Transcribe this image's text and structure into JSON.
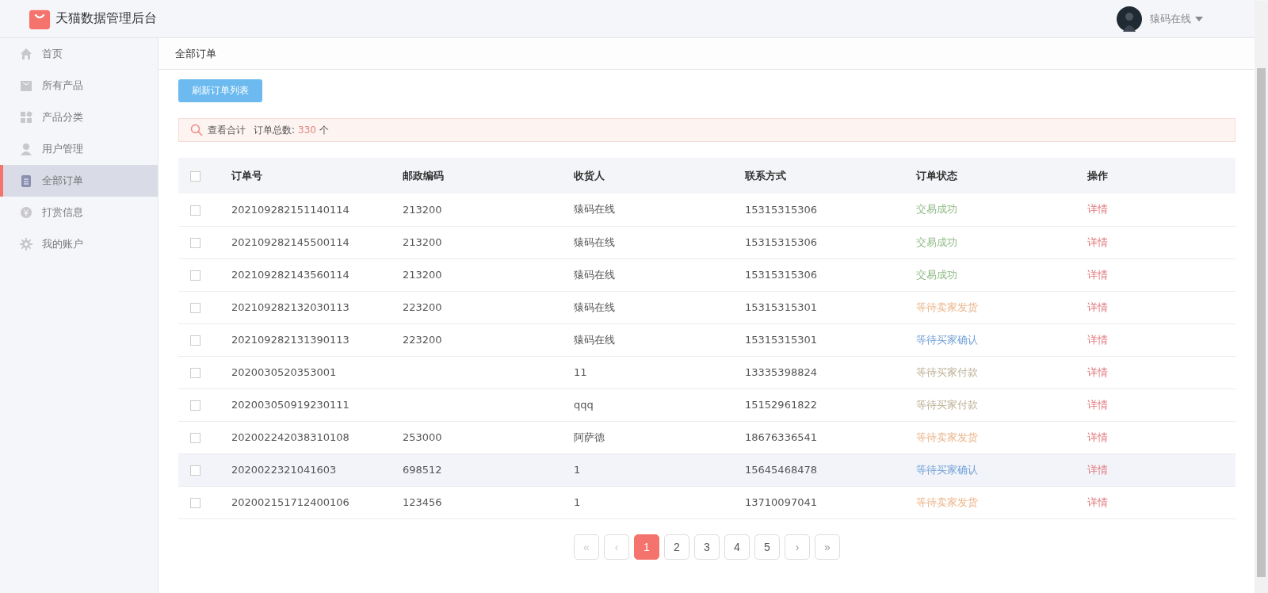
{
  "header": {
    "title": "天猫数据管理后台",
    "user": "猿码在线"
  },
  "sidebar": {
    "items": [
      {
        "label": "首页",
        "selected": false
      },
      {
        "label": "所有产品",
        "selected": false
      },
      {
        "label": "产品分类",
        "selected": false
      },
      {
        "label": "用户管理",
        "selected": false
      },
      {
        "label": "全部订单",
        "selected": true
      },
      {
        "label": "打赏信息",
        "selected": false
      },
      {
        "label": "我的账户",
        "selected": false
      }
    ]
  },
  "breadcrumb": "全部订单",
  "refresh_button": "刷新订单列表",
  "summary": {
    "label": "查看合计",
    "total_label": "订单总数:",
    "total": "330",
    "unit": "个"
  },
  "table": {
    "select_all_checked": false,
    "columns": [
      "订单号",
      "邮政编码",
      "收货人",
      "联系方式",
      "订单状态",
      "操作"
    ],
    "rows": [
      {
        "order_no": "202109282151140114",
        "postcode": "213200",
        "receiver": "猿码在线",
        "phone": "15315315306",
        "status": "交易成功",
        "color": "#8db883",
        "action": "详情",
        "checked": false,
        "highlighted": false
      },
      {
        "order_no": "202109282145500114",
        "postcode": "213200",
        "receiver": "猿码在线",
        "phone": "15315315306",
        "status": "交易成功",
        "color": "#8db883",
        "action": "详情",
        "checked": false,
        "highlighted": false
      },
      {
        "order_no": "202109282143560114",
        "postcode": "213200",
        "receiver": "猿码在线",
        "phone": "15315315306",
        "status": "交易成功",
        "color": "#8db883",
        "action": "详情",
        "checked": false,
        "highlighted": false
      },
      {
        "order_no": "202109282132030113",
        "postcode": "223200",
        "receiver": "猿码在线",
        "phone": "15315315301",
        "status": "等待卖家发货",
        "color": "#eab48a",
        "action": "详情",
        "checked": false,
        "highlighted": false
      },
      {
        "order_no": "202109282131390113",
        "postcode": "223200",
        "receiver": "猿码在线",
        "phone": "15315315301",
        "status": "等待买家确认",
        "color": "#6f9fd4",
        "action": "详情",
        "checked": false,
        "highlighted": false
      },
      {
        "order_no": "2020030520353001",
        "receiver": "11",
        "phone": "13335398824",
        "status": "等待买家付款",
        "color": "#bcae94",
        "action": "详情",
        "checked": false,
        "highlighted": false
      },
      {
        "order_no": "202003050919230111",
        "receiver": "qqq",
        "phone": "15152961822",
        "status": "等待买家付款",
        "color": "#bcae94",
        "action": "详情",
        "checked": false,
        "highlighted": false
      },
      {
        "order_no": "202002242038310108",
        "postcode": "253000",
        "receiver": "阿萨德",
        "phone": "18676336541",
        "status": "等待卖家发货",
        "color": "#eab48a",
        "action": "详情",
        "checked": false,
        "highlighted": false
      },
      {
        "order_no": "2020022321041603",
        "postcode": "698512",
        "receiver": "1",
        "phone": "15645468478",
        "status": "等待买家确认",
        "color": "#6f9fd4",
        "action": "详情",
        "checked": false,
        "highlighted": true
      },
      {
        "order_no": "202002151712400106",
        "postcode": "123456",
        "receiver": "1",
        "phone": "13710097041",
        "status": "等待卖家发货",
        "color": "#eab48a",
        "action": "详情",
        "checked": false,
        "highlighted": false
      }
    ]
  },
  "pagination": [
    {
      "label": "«",
      "kind": "nav",
      "disabled": true,
      "selected": false
    },
    {
      "label": "‹",
      "kind": "nav",
      "disabled": true,
      "selected": false
    },
    {
      "label": "1",
      "kind": "page",
      "disabled": false,
      "selected": true
    },
    {
      "label": "2",
      "kind": "page",
      "disabled": false,
      "selected": false
    },
    {
      "label": "3",
      "kind": "page",
      "disabled": false,
      "selected": false
    },
    {
      "label": "4",
      "kind": "page",
      "disabled": false,
      "selected": false
    },
    {
      "label": "5",
      "kind": "page",
      "disabled": false,
      "selected": false
    },
    {
      "label": "›",
      "kind": "nav",
      "disabled": false,
      "selected": false
    },
    {
      "label": "»",
      "kind": "nav",
      "disabled": false,
      "selected": false
    }
  ]
}
